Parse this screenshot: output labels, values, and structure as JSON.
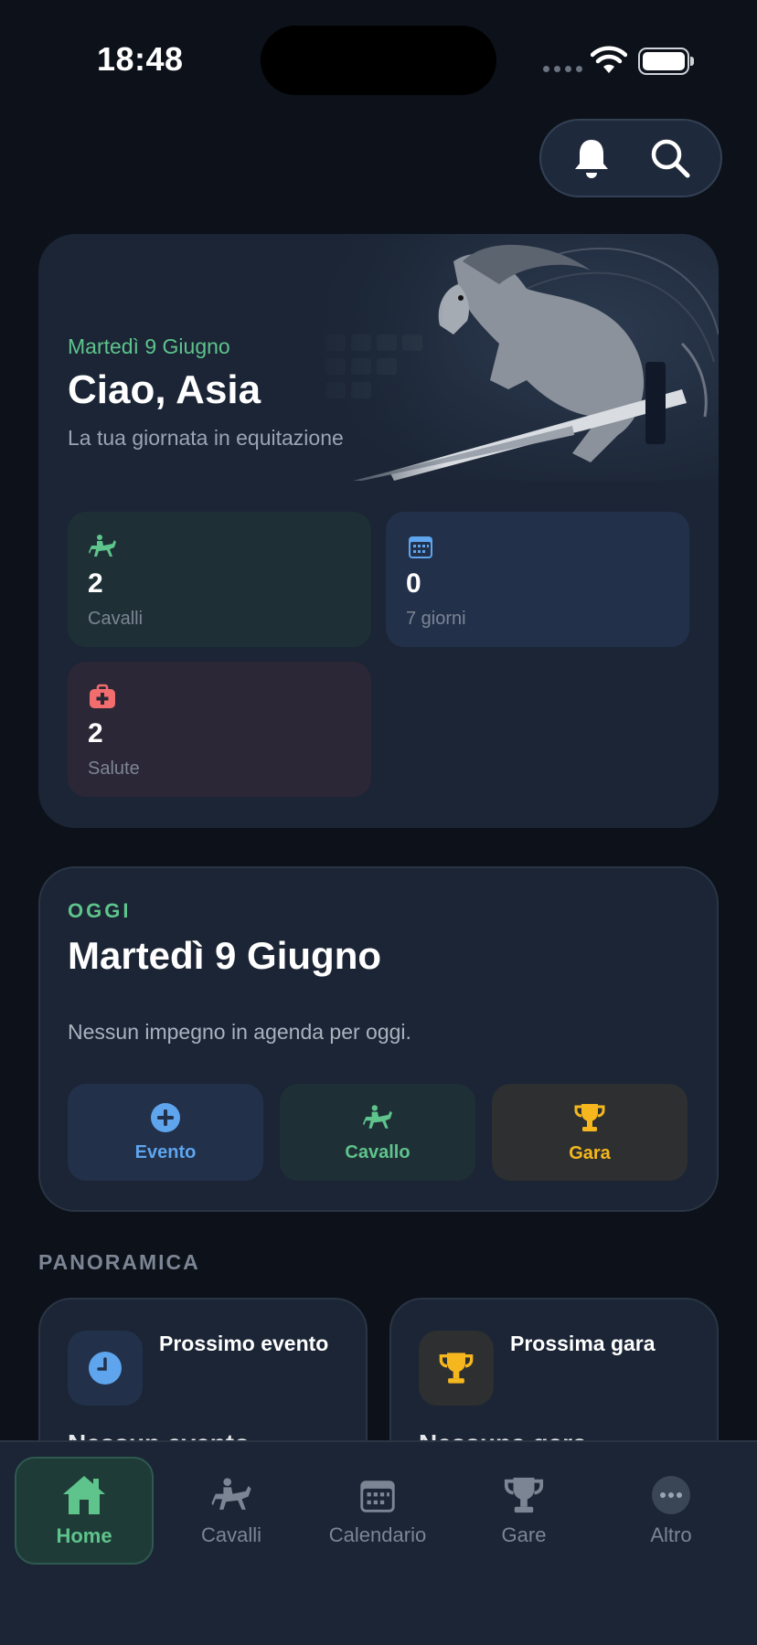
{
  "status_bar": {
    "time": "18:48"
  },
  "hero": {
    "date": "Martedì 9 Giugno",
    "greeting": "Ciao, Asia",
    "subtitle": "La tua giornata in equitazione",
    "stats": [
      {
        "value": "2",
        "label": "Cavalli",
        "icon": "horse-rider-icon",
        "color": "#5ec48c"
      },
      {
        "value": "0",
        "label": "7 giorni",
        "icon": "calendar-icon",
        "color": "#5ea5ee"
      },
      {
        "value": "2",
        "label": "Salute",
        "icon": "medical-kit-icon",
        "color": "#f26d6d"
      }
    ]
  },
  "today": {
    "kicker": "OGGI",
    "title": "Martedì 9 Giugno",
    "empty_message": "Nessun impegno in agenda per oggi.",
    "actions": [
      {
        "label": "Evento",
        "icon": "plus-circle-icon",
        "color": "#5ea5ee"
      },
      {
        "label": "Cavallo",
        "icon": "horse-rider-icon",
        "color": "#5ec48c"
      },
      {
        "label": "Gara",
        "icon": "trophy-icon",
        "color": "#f5b71d"
      }
    ]
  },
  "overview": {
    "section_title": "PANORAMICA",
    "cards": [
      {
        "title": "Prossimo evento",
        "body": "Nessun evento",
        "icon": "clock-icon"
      },
      {
        "title": "Prossima gara",
        "body": "Nessuna gara",
        "icon": "trophy-icon"
      }
    ]
  },
  "tabbar": {
    "tabs": [
      {
        "label": "Home",
        "icon": "home-icon",
        "active": true
      },
      {
        "label": "Cavalli",
        "icon": "horse-rider-icon",
        "active": false
      },
      {
        "label": "Calendario",
        "icon": "calendar-icon",
        "active": false
      },
      {
        "label": "Gare",
        "icon": "trophy-icon",
        "active": false
      },
      {
        "label": "Altro",
        "icon": "more-icon",
        "active": false
      }
    ]
  },
  "colors": {
    "background": "#0c111a",
    "card": "#1b2535",
    "accent_green": "#5ec48c",
    "accent_blue": "#5ea5ee",
    "accent_gold": "#f5b71d",
    "accent_red": "#f26d6d"
  }
}
